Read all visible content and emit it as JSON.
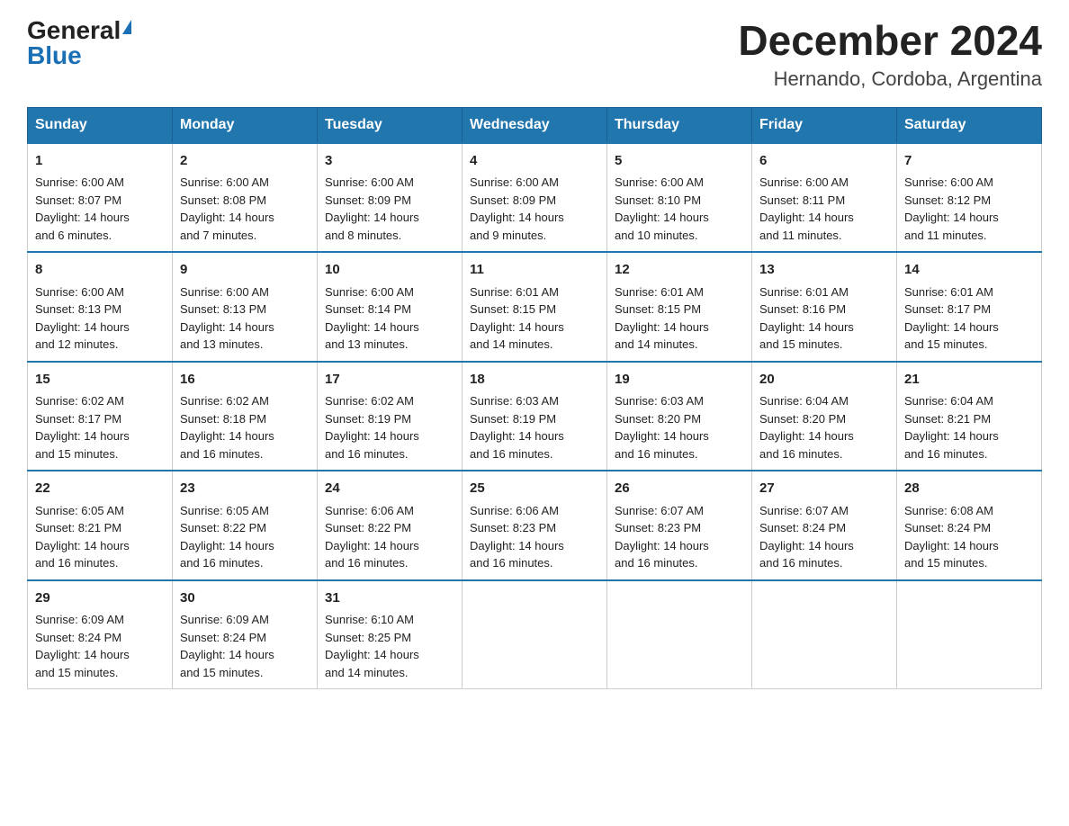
{
  "header": {
    "logo_general": "General",
    "logo_blue": "Blue",
    "month_year": "December 2024",
    "location": "Hernando, Cordoba, Argentina"
  },
  "days_of_week": [
    "Sunday",
    "Monday",
    "Tuesday",
    "Wednesday",
    "Thursday",
    "Friday",
    "Saturday"
  ],
  "weeks": [
    [
      {
        "day": 1,
        "info": "Sunrise: 6:00 AM\nSunset: 8:07 PM\nDaylight: 14 hours\nand 6 minutes."
      },
      {
        "day": 2,
        "info": "Sunrise: 6:00 AM\nSunset: 8:08 PM\nDaylight: 14 hours\nand 7 minutes."
      },
      {
        "day": 3,
        "info": "Sunrise: 6:00 AM\nSunset: 8:09 PM\nDaylight: 14 hours\nand 8 minutes."
      },
      {
        "day": 4,
        "info": "Sunrise: 6:00 AM\nSunset: 8:09 PM\nDaylight: 14 hours\nand 9 minutes."
      },
      {
        "day": 5,
        "info": "Sunrise: 6:00 AM\nSunset: 8:10 PM\nDaylight: 14 hours\nand 10 minutes."
      },
      {
        "day": 6,
        "info": "Sunrise: 6:00 AM\nSunset: 8:11 PM\nDaylight: 14 hours\nand 11 minutes."
      },
      {
        "day": 7,
        "info": "Sunrise: 6:00 AM\nSunset: 8:12 PM\nDaylight: 14 hours\nand 11 minutes."
      }
    ],
    [
      {
        "day": 8,
        "info": "Sunrise: 6:00 AM\nSunset: 8:13 PM\nDaylight: 14 hours\nand 12 minutes."
      },
      {
        "day": 9,
        "info": "Sunrise: 6:00 AM\nSunset: 8:13 PM\nDaylight: 14 hours\nand 13 minutes."
      },
      {
        "day": 10,
        "info": "Sunrise: 6:00 AM\nSunset: 8:14 PM\nDaylight: 14 hours\nand 13 minutes."
      },
      {
        "day": 11,
        "info": "Sunrise: 6:01 AM\nSunset: 8:15 PM\nDaylight: 14 hours\nand 14 minutes."
      },
      {
        "day": 12,
        "info": "Sunrise: 6:01 AM\nSunset: 8:15 PM\nDaylight: 14 hours\nand 14 minutes."
      },
      {
        "day": 13,
        "info": "Sunrise: 6:01 AM\nSunset: 8:16 PM\nDaylight: 14 hours\nand 15 minutes."
      },
      {
        "day": 14,
        "info": "Sunrise: 6:01 AM\nSunset: 8:17 PM\nDaylight: 14 hours\nand 15 minutes."
      }
    ],
    [
      {
        "day": 15,
        "info": "Sunrise: 6:02 AM\nSunset: 8:17 PM\nDaylight: 14 hours\nand 15 minutes."
      },
      {
        "day": 16,
        "info": "Sunrise: 6:02 AM\nSunset: 8:18 PM\nDaylight: 14 hours\nand 16 minutes."
      },
      {
        "day": 17,
        "info": "Sunrise: 6:02 AM\nSunset: 8:19 PM\nDaylight: 14 hours\nand 16 minutes."
      },
      {
        "day": 18,
        "info": "Sunrise: 6:03 AM\nSunset: 8:19 PM\nDaylight: 14 hours\nand 16 minutes."
      },
      {
        "day": 19,
        "info": "Sunrise: 6:03 AM\nSunset: 8:20 PM\nDaylight: 14 hours\nand 16 minutes."
      },
      {
        "day": 20,
        "info": "Sunrise: 6:04 AM\nSunset: 8:20 PM\nDaylight: 14 hours\nand 16 minutes."
      },
      {
        "day": 21,
        "info": "Sunrise: 6:04 AM\nSunset: 8:21 PM\nDaylight: 14 hours\nand 16 minutes."
      }
    ],
    [
      {
        "day": 22,
        "info": "Sunrise: 6:05 AM\nSunset: 8:21 PM\nDaylight: 14 hours\nand 16 minutes."
      },
      {
        "day": 23,
        "info": "Sunrise: 6:05 AM\nSunset: 8:22 PM\nDaylight: 14 hours\nand 16 minutes."
      },
      {
        "day": 24,
        "info": "Sunrise: 6:06 AM\nSunset: 8:22 PM\nDaylight: 14 hours\nand 16 minutes."
      },
      {
        "day": 25,
        "info": "Sunrise: 6:06 AM\nSunset: 8:23 PM\nDaylight: 14 hours\nand 16 minutes."
      },
      {
        "day": 26,
        "info": "Sunrise: 6:07 AM\nSunset: 8:23 PM\nDaylight: 14 hours\nand 16 minutes."
      },
      {
        "day": 27,
        "info": "Sunrise: 6:07 AM\nSunset: 8:24 PM\nDaylight: 14 hours\nand 16 minutes."
      },
      {
        "day": 28,
        "info": "Sunrise: 6:08 AM\nSunset: 8:24 PM\nDaylight: 14 hours\nand 15 minutes."
      }
    ],
    [
      {
        "day": 29,
        "info": "Sunrise: 6:09 AM\nSunset: 8:24 PM\nDaylight: 14 hours\nand 15 minutes."
      },
      {
        "day": 30,
        "info": "Sunrise: 6:09 AM\nSunset: 8:24 PM\nDaylight: 14 hours\nand 15 minutes."
      },
      {
        "day": 31,
        "info": "Sunrise: 6:10 AM\nSunset: 8:25 PM\nDaylight: 14 hours\nand 14 minutes."
      },
      null,
      null,
      null,
      null
    ]
  ]
}
